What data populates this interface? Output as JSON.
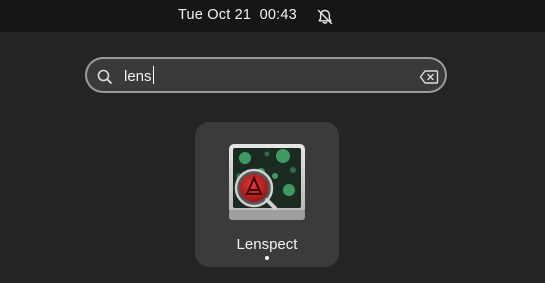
{
  "topbar": {
    "clock": "Tue Oct 21  00:43",
    "notification_icon": "bell-muted-icon"
  },
  "search": {
    "query": "lens",
    "icon": "search-icon",
    "clear_icon": "clear-text-icon"
  },
  "results": [
    {
      "name": "Lenspect",
      "icon": "lenspect-app-icon",
      "running": true
    }
  ],
  "colors": {
    "background": "#242424",
    "topbar": "#161616",
    "tile": "#3b3b3b",
    "search_field": "#3a3a3a"
  }
}
